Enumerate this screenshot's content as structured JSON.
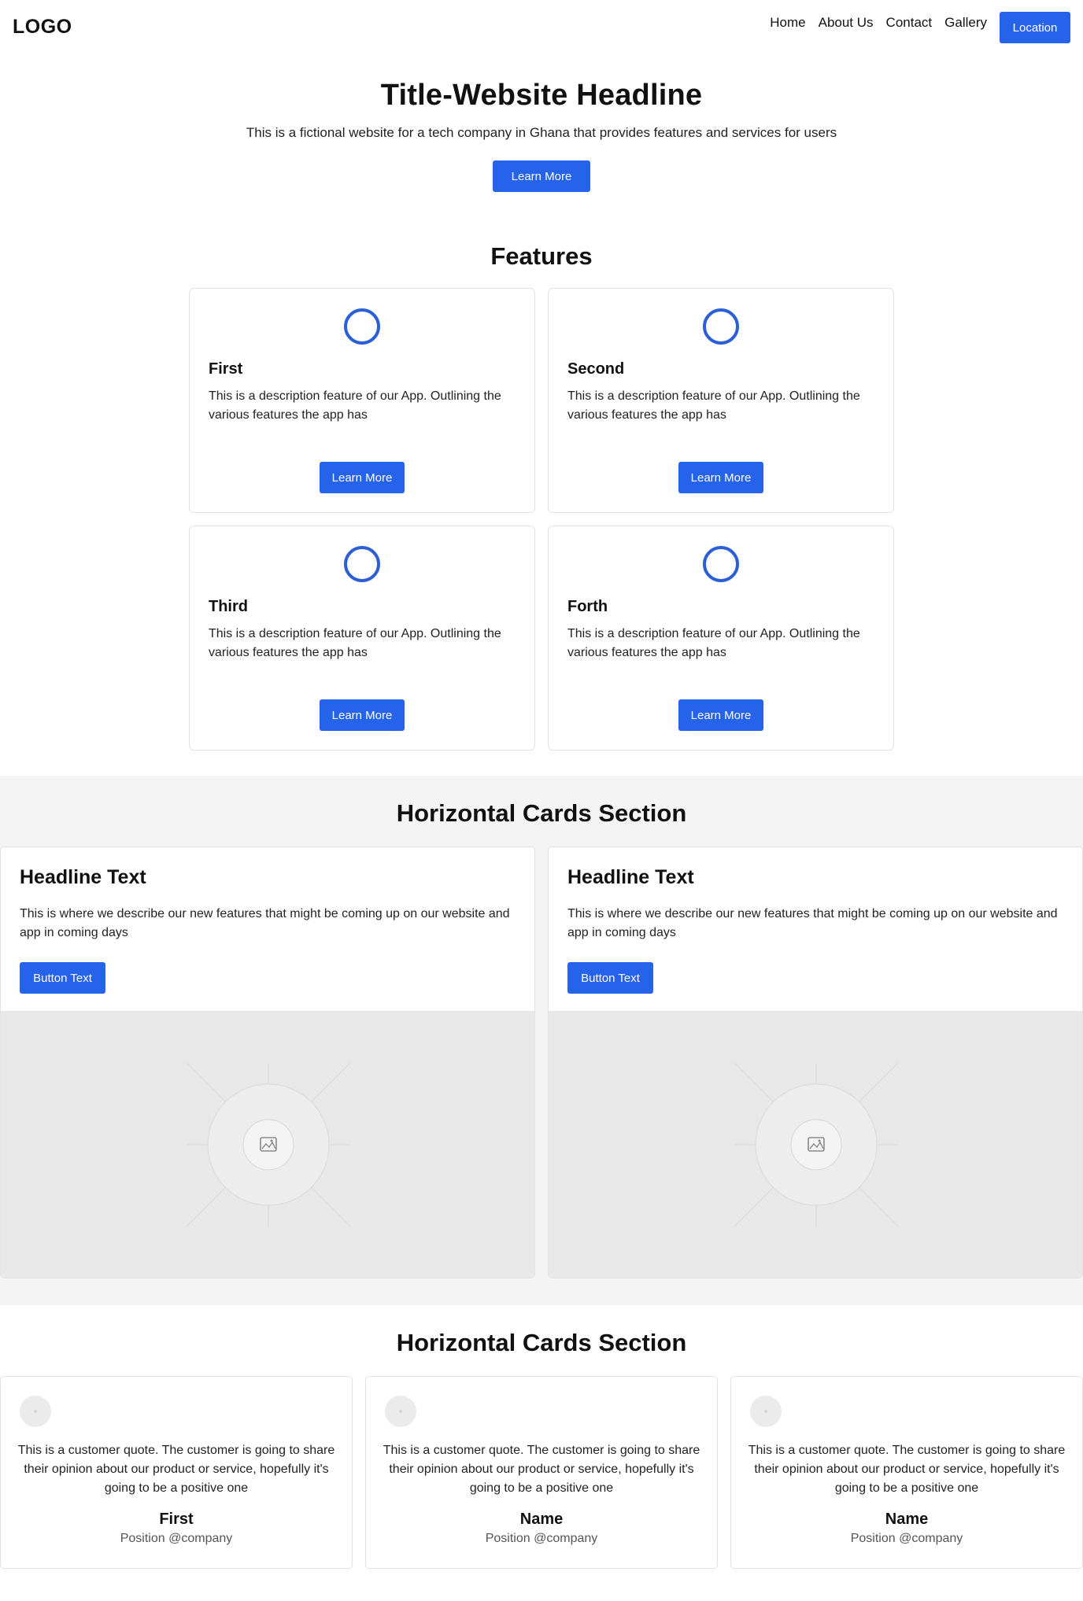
{
  "nav": {
    "logo": "LOGO",
    "links": [
      "Home",
      "About Us",
      "Contact",
      "Gallery"
    ],
    "cta_label": "Location"
  },
  "hero": {
    "title": "Title-Website Headline",
    "subtitle": "This is a fictional website for a tech company in Ghana that provides features and services for users",
    "button_label": "Learn More"
  },
  "features": {
    "heading": "Features",
    "items": [
      {
        "title": "First",
        "description": "This is a description feature of our App. Outlining the various features the app has",
        "button_label": "Learn More"
      },
      {
        "title": "Second",
        "description": "This is a description feature of our App. Outlining the various features the app has",
        "button_label": "Learn More"
      },
      {
        "title": "Third",
        "description": "This is a description feature of our App. Outlining the various features the app has",
        "button_label": "Learn More"
      },
      {
        "title": "Forth",
        "description": "This is a description feature of our App. Outlining the various features the app has",
        "button_label": "Learn More"
      }
    ]
  },
  "horizontal_cards": {
    "heading": "Horizontal Cards Section",
    "items": [
      {
        "title": "Headline Text",
        "description": "This is where we describe our new features that might be coming up on our website and app in coming days",
        "button_label": "Button Text",
        "image_icon": "image-placeholder-icon"
      },
      {
        "title": "Headline Text",
        "description": "This is where we describe our new features that might be coming up on our website and app in coming days",
        "button_label": "Button Text",
        "image_icon": "image-placeholder-icon"
      }
    ]
  },
  "testimonials": {
    "heading": "Horizontal Cards Section",
    "items": [
      {
        "quote": "This is a customer quote. The customer is going to share their opinion about our product or service, hopefully it's going to be a positive one",
        "name": "First",
        "position": "Position @company"
      },
      {
        "quote": "This is a customer quote. The customer is going to share their opinion about our product or service, hopefully it's going to be a positive one",
        "name": "Name",
        "position": "Position @company"
      },
      {
        "quote": "This is a customer quote. The customer is going to share their opinion about our product or service, hopefully it's going to be a positive one",
        "name": "Name",
        "position": "Position @company"
      }
    ]
  },
  "colors": {
    "accent": "#2563eb",
    "section_bg": "#f4f4f5",
    "image_placeholder_bg": "#e8e8e8"
  }
}
